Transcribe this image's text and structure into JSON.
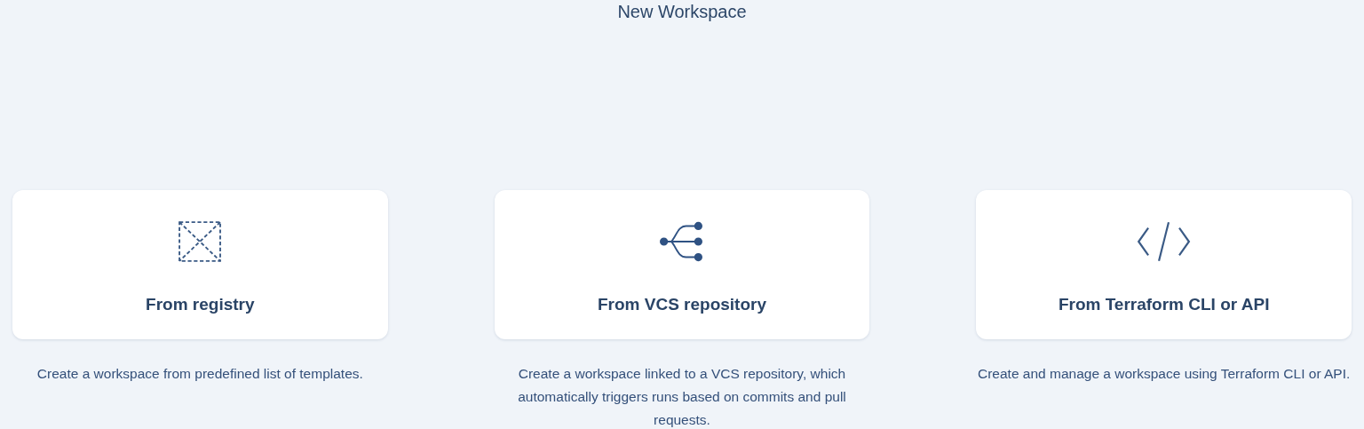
{
  "title": "New Workspace",
  "options": [
    {
      "kind": "registry",
      "label": "From registry",
      "description": "Create a workspace from predefined list of templates."
    },
    {
      "kind": "vcs",
      "label": "From VCS repository",
      "description": "Create a workspace linked to a VCS repository, which automatically triggers runs based on commits and pull requests."
    },
    {
      "kind": "cli",
      "label": "From Terraform CLI or API",
      "description": "Create and manage a workspace using Terraform CLI or API."
    }
  ]
}
